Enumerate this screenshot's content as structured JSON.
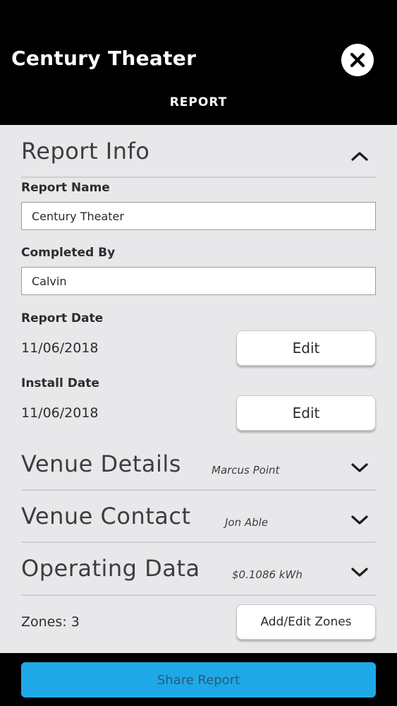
{
  "header": {
    "title": "Century Theater",
    "subtitle": "REPORT"
  },
  "report_info": {
    "title": "Report Info",
    "report_name_label": "Report Name",
    "report_name_value": "Century Theater",
    "completed_by_label": "Completed By",
    "completed_by_value": "Calvin",
    "report_date_label": "Report Date",
    "report_date_value": "11/06/2018",
    "install_date_label": "Install Date",
    "install_date_value": "11/06/2018",
    "edit_label": "Edit"
  },
  "venue_details": {
    "title": "Venue Details",
    "subtitle": "Marcus Point"
  },
  "venue_contact": {
    "title": "Venue Contact",
    "subtitle": "Jon Able"
  },
  "operating_data": {
    "title": "Operating Data",
    "subtitle": "$0.1086 kWh"
  },
  "zones": {
    "text": "Zones: 3",
    "button_label": "Add/Edit Zones"
  },
  "footer": {
    "share_label": "Share Report"
  },
  "colors": {
    "header_bg": "#000000",
    "content_bg": "#e8e8ea",
    "share_button": "#1ea9e6",
    "share_text": "#2d5a78"
  },
  "icons": {
    "close": "close-icon",
    "collapse": "chevron-up-icon",
    "expand": "chevron-down-icon"
  }
}
